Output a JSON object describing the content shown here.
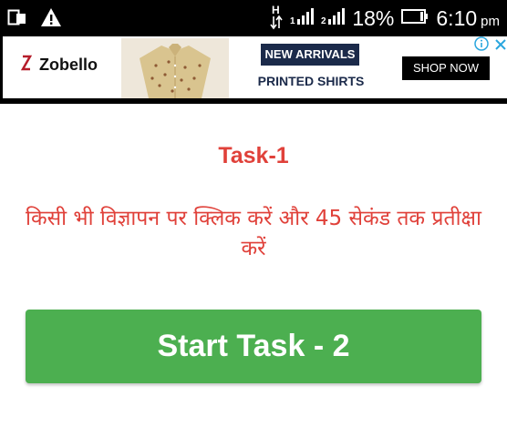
{
  "status_bar": {
    "icons": [
      "screen-mirror-icon",
      "warning-icon",
      "data-transfer-icon",
      "signal-sim1-icon",
      "signal-sim2-icon",
      "battery-icon"
    ],
    "battery": "18%",
    "time": "6:10",
    "ampm": "pm"
  },
  "ad": {
    "brand": "Zobello",
    "headline": "NEW ARRIVALS",
    "subline": "PRINTED SHIRTS",
    "cta": "SHOP NOW",
    "icons": [
      "brand-logo-icon",
      "shirt-image",
      "adchoices-info-icon",
      "close-icon"
    ],
    "colors": {
      "headline_bg": "#1b2a4a",
      "cta_bg": "#000000",
      "adchoices": "#2aa6de"
    }
  },
  "content": {
    "title": "Task-1",
    "instruction": "किसी भी विज्ञापन पर क्लिक करें और 45 सेकंड तक प्रतीक्षा करें",
    "button_label": "Start Task - 2",
    "colors": {
      "text": "#e0413a",
      "button": "#4caf50"
    }
  }
}
